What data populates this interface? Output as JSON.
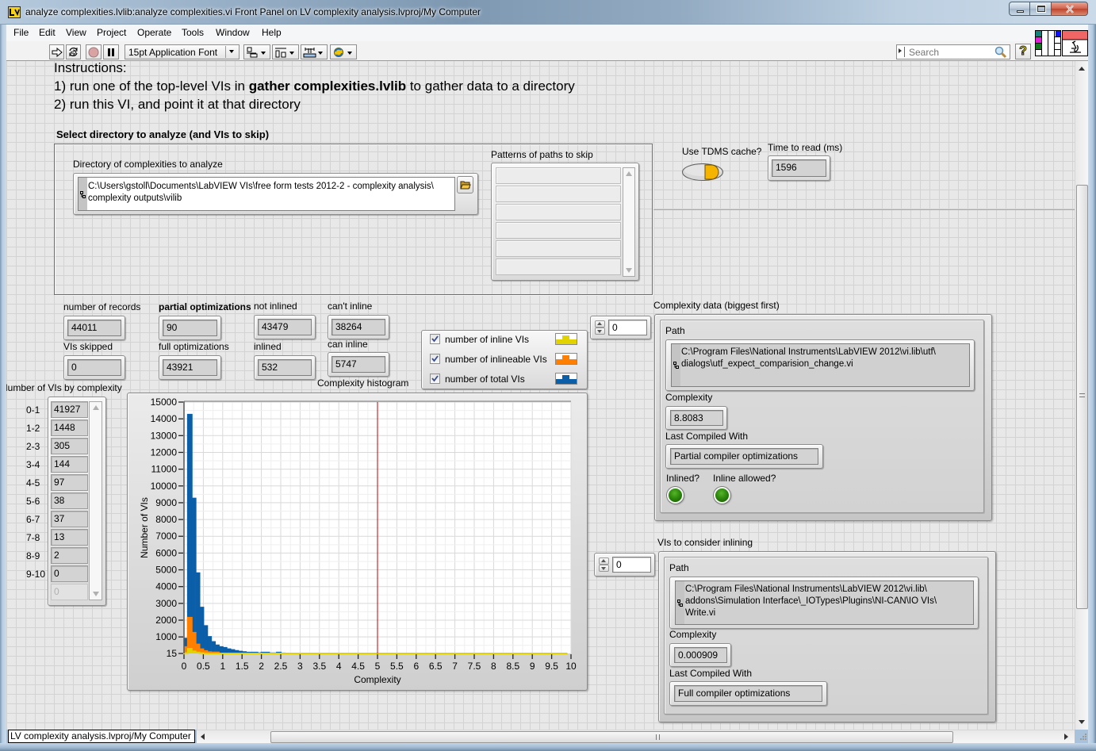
{
  "window": {
    "title": "analyze complexities.lvlib:analyze complexities.vi Front Panel on LV complexity analysis.lvproj/My Computer"
  },
  "menu": [
    "File",
    "Edit",
    "View",
    "Project",
    "Operate",
    "Tools",
    "Window",
    "Help"
  ],
  "toolbar": {
    "font_select": "15pt Application Font",
    "search_placeholder": "Search",
    "help": "?"
  },
  "instructions": {
    "heading": "Instructions:",
    "step1_pre": "1) run one of the top-level VIs in ",
    "step1_bold": "gather complexities.lvlib",
    "step1_post": " to gather data to a directory",
    "step2": "2) run this VI, and point it at that directory"
  },
  "select": {
    "label": "Select directory to analyze (and VIs to skip)",
    "directory": {
      "label": "Directory of complexities to analyze",
      "lines": [
        "C:\\Users\\gstoll\\Documents\\LabVIEW VIs\\free form tests 2012-2 - complexity analysis\\",
        "complexity outputs\\vilib"
      ]
    },
    "patterns": {
      "label": "Patterns of paths to skip",
      "values": [
        "",
        "",
        "",
        "",
        "",
        ""
      ]
    }
  },
  "tdms_cache": {
    "label": "Use TDMS cache?",
    "on": true
  },
  "time_to_read": {
    "label": "Time to read (ms)",
    "value": "1596"
  },
  "stats": {
    "records": {
      "label": "number of records",
      "value": "44011"
    },
    "skipped": {
      "label": "VIs skipped",
      "value": "0"
    },
    "partial": {
      "label": "partial optimizations",
      "value": "90"
    },
    "full": {
      "label": "full optimizations",
      "value": "43921"
    },
    "not_inlined": {
      "label": "not inlined",
      "value": "43479"
    },
    "inlined": {
      "label": "inlined",
      "value": "532"
    },
    "cant_inline": {
      "label": "can't inline",
      "value": "38264"
    },
    "can_inline": {
      "label": "can inline",
      "value": "5747"
    }
  },
  "legend": [
    {
      "label": "number of inline VIs",
      "checked": true,
      "color": "#e2d200"
    },
    {
      "label": "number of inlineable VIs",
      "checked": true,
      "color": "#ff8000"
    },
    {
      "label": "number of total VIs",
      "checked": true,
      "color": "#0b5ea8"
    }
  ],
  "by_complexity": {
    "label": "Number of VIs by complexity",
    "rows": [
      {
        "range": "0-1",
        "count": "41927"
      },
      {
        "range": "1-2",
        "count": "1448"
      },
      {
        "range": "2-3",
        "count": "305"
      },
      {
        "range": "3-4",
        "count": "144"
      },
      {
        "range": "4-5",
        "count": "97"
      },
      {
        "range": "5-6",
        "count": "38"
      },
      {
        "range": "6-7",
        "count": "37"
      },
      {
        "range": "7-8",
        "count": "13"
      },
      {
        "range": "8-9",
        "count": "2"
      },
      {
        "range": "9-10",
        "count": "0"
      }
    ],
    "empty_cell": "0"
  },
  "chart_data": {
    "type": "bar",
    "style": "step-histogram",
    "title": "Complexity histogram",
    "xlabel": "Complexity",
    "ylabel": "Number of VIs",
    "xlim": [
      0,
      10
    ],
    "ylim": [
      15,
      15000
    ],
    "xticks": [
      "0",
      "0.5",
      "1",
      "1.5",
      "2",
      "2.5",
      "3",
      "3.5",
      "4",
      "4.5",
      "5",
      "5.5",
      "6",
      "6.5",
      "7",
      "7.5",
      "8",
      "8.5",
      "9",
      "9.5",
      "10"
    ],
    "yticks": [
      15,
      1000,
      2000,
      3000,
      4000,
      5000,
      6000,
      7000,
      8000,
      9000,
      10000,
      11000,
      12000,
      13000,
      14000,
      15000
    ],
    "grid": {
      "on": true,
      "x_major": 0.5,
      "x_minor": 0.25,
      "y_major": 1000,
      "y_minor": 500
    },
    "bin_start": 0,
    "bin_width": 0.1,
    "bin_count": 100,
    "values_note": "bins beyond listed values are 0",
    "series": [
      {
        "name": "number of inline VIs",
        "color": "#e2d200",
        "values": [
          40,
          300,
          140,
          75,
          40,
          20,
          10,
          5,
          5,
          0
        ]
      },
      {
        "name": "number of inlineable VIs",
        "color": "#ff8000",
        "values": [
          400,
          2150,
          1250,
          550,
          270,
          160,
          100,
          80,
          80,
          10
        ]
      },
      {
        "name": "number of total VIs",
        "color": "#0b5ea8",
        "values": [
          900,
          14250,
          9250,
          4800,
          2750,
          1650,
          1000,
          700,
          500,
          400,
          350,
          270,
          220,
          170,
          130,
          100,
          70,
          70,
          70,
          30,
          70,
          70,
          25,
          25,
          70,
          20
        ]
      }
    ],
    "cursor": {
      "x": 5,
      "color": "#c00000"
    },
    "legend_placement": "top-right"
  },
  "complexity_data": {
    "label": "Complexity data (biggest first)",
    "index": "0",
    "path_label": "Path",
    "path_lines": [
      "C:\\Program Files\\National Instruments\\LabVIEW 2012\\vi.lib\\utf\\",
      "dialogs\\utf_expect_comparision_change.vi"
    ],
    "complexity_label": "Complexity",
    "complexity": "8.8083",
    "compiled_label": "Last Compiled With",
    "compiled": "Partial compiler optimizations",
    "inlined_label": "Inlined?",
    "inlined": true,
    "inline_allowed_label": "Inline allowed?",
    "inline_allowed": true
  },
  "consider_inlining": {
    "label": "VIs to consider inlining",
    "index": "0",
    "path_label": "Path",
    "path_lines": [
      "C:\\Program Files\\National Instruments\\LabVIEW 2012\\vi.lib\\",
      "addons\\Simulation Interface\\_IOTypes\\Plugins\\NI-CAN\\IO VIs\\",
      "Write.vi"
    ],
    "complexity_label": "Complexity",
    "complexity": "0.000909",
    "compiled_label": "Last Compiled With",
    "compiled": "Full compiler optimizations"
  },
  "status_bar": {
    "project": "LV complexity analysis.lvproj/My Computer"
  }
}
